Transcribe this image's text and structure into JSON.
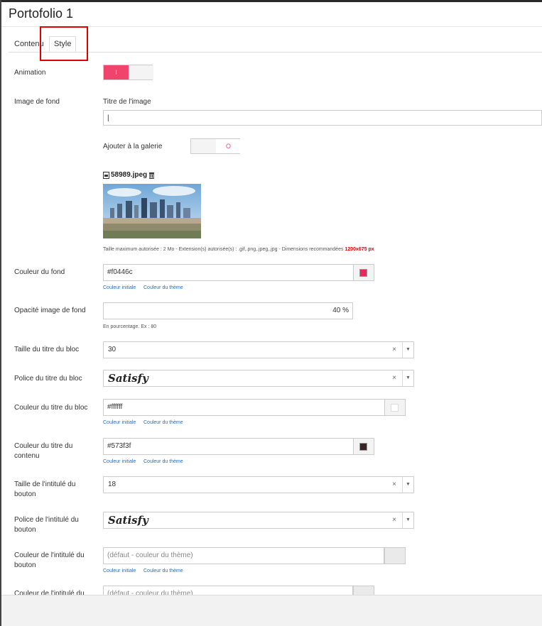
{
  "header": {
    "title": "Portofolio 1"
  },
  "tabs": [
    {
      "label": "Contenu"
    },
    {
      "label": "Style"
    }
  ],
  "animation": {
    "label": "Animation",
    "on_label": "I"
  },
  "background_image": {
    "label": "Image de fond",
    "title_label": "Titre de l'image",
    "title_value": "",
    "gallery_label": "Ajouter à la galerie",
    "gallery_off_label": "O",
    "file_name": "58989.jpeg",
    "help_text": "Taille maximum autorisée : 2 Mo - Extension(s) autorisée(s) : .gif,.png,.jpeg,.jpg - Dimensions recommandées",
    "help_dims": "1200x675 px"
  },
  "bg_color": {
    "label": "Couleur du fond",
    "value": "#f0446c",
    "swatch": "#e8285a",
    "link_initial": "Couleur initiale",
    "link_theme": "Couleur du thème"
  },
  "bg_opacity": {
    "label": "Opacité image de fond",
    "value": "40 %",
    "help": "En pourcentage. Ex : 80"
  },
  "block_title_size": {
    "label": "Taille du titre du bloc",
    "value": "30",
    "clear": "×",
    "arrow": "▼"
  },
  "block_title_font": {
    "label": "Police du titre du bloc",
    "value": "Satisfy",
    "clear": "×",
    "arrow": "▼"
  },
  "block_title_color": {
    "label": "Couleur du titre du bloc",
    "value": "#ffffff",
    "swatch": "#ffffff",
    "link_initial": "Couleur initiale",
    "link_theme": "Couleur du thème"
  },
  "content_title_color": {
    "label": "Couleur du titre du contenu",
    "value": "#573f3f",
    "swatch": "#3b2424",
    "link_initial": "Couleur initiale",
    "link_theme": "Couleur du thème"
  },
  "button_label_size": {
    "label": "Taille de l'intitulé du bouton",
    "value": "18",
    "clear": "×",
    "arrow": "▼"
  },
  "button_label_font": {
    "label": "Police de l'intitulé du bouton",
    "value": "Satisfy",
    "clear": "×",
    "arrow": "▼"
  },
  "button_label_color": {
    "label": "Couleur de l'intitulé du bouton",
    "placeholder": "(défaut - couleur du thème)",
    "link_initial": "Couleur initiale",
    "link_theme": "Couleur du thème"
  },
  "next_field": {
    "label": "Couleur de l'intitulé du",
    "placeholder": "(défaut - couleur du thème)"
  },
  "colors": {
    "accent": "#f0446c",
    "highlight": "#e00000",
    "link": "#2a6ebb"
  }
}
